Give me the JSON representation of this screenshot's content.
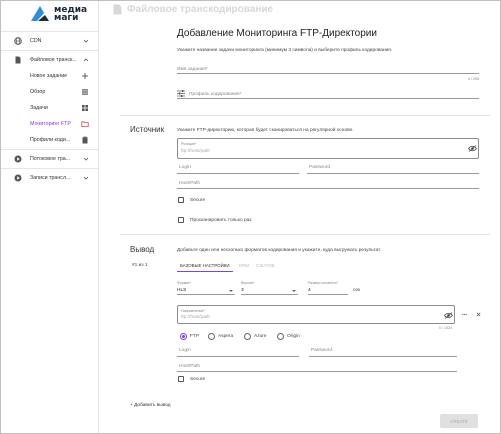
{
  "brand": {
    "line1": "медиа",
    "line2": "маги"
  },
  "header": {
    "title": "Файловое транскодирование"
  },
  "sidebar": {
    "items": [
      {
        "label": "CDN",
        "icon": "globe-icon"
      },
      {
        "label": "Файловое транск...",
        "icon": "file-icon"
      },
      {
        "label": "Новое задание",
        "action_icon": "plus-icon"
      },
      {
        "label": "Обзор",
        "action_icon": "list-icon"
      },
      {
        "label": "Задачи",
        "action_icon": "grid-icon"
      },
      {
        "label": "Мониторинг FTP",
        "action_icon": "folder-icon"
      },
      {
        "label": "Профили коди...",
        "action_icon": "clipboard-icon"
      },
      {
        "label": "Потоковое тра...",
        "icon": "play-circle-icon"
      },
      {
        "label": "Записи трансл...",
        "icon": "play-circle-icon"
      }
    ]
  },
  "form": {
    "title": "Добавление Мониторинга FTP-Директории",
    "intro": "Укажите название задачи мониторинга (минимум 3 символа) и выберите профиль кодирования.",
    "task_name_placeholder": "Имя задания*",
    "task_name_counter": "0 / 255",
    "profile_placeholder": "Профиль кодирования*",
    "source": {
      "title": "Источник",
      "hint": "Укажите FTP-директорию, которая будет сканироваться на регулярной основе.",
      "path_label": "Розиция*",
      "path_placeholder": "ftp://host/path",
      "login_placeholder": "Login",
      "password_placeholder": "Password",
      "hostpath_placeholder": "Host/Path",
      "secure_label": "Secure",
      "scan_once_label": "Просканировать только раз"
    },
    "output": {
      "title": "Вывод",
      "hint": "Добавьте один или несколько форматов кодирования и укажите, куда выгружать результат.",
      "counter": "#1 из 1",
      "tabs": [
        "БАЗОВЫЕ НАСТРОЙКИ",
        "DRM",
        "СЖАТИЕ"
      ],
      "format_label": "Формат*",
      "format_value": "HLS",
      "version_label": "Версия*",
      "version_value": "3",
      "segment_label": "Размер сегмента*",
      "segment_value": "4",
      "segment_unit": "сек",
      "destination_label": "Направление*",
      "destination_placeholder": "ftp://host/path",
      "destination_counter": "0 / 1024",
      "protocols": [
        "FTP",
        "Aspera",
        "Azure",
        "Origin"
      ],
      "protocol_selected": "FTP",
      "login_placeholder": "Login",
      "password_placeholder": "Password",
      "hostpath_placeholder": "Host/Path",
      "secure_label": "Secure",
      "add_output_label": "+ Добавить вывод"
    },
    "create_label": "CREATE"
  },
  "colors": {
    "accent": "#7e43d8",
    "logo_blue": "#2f8fd6",
    "logo_navy": "#1d2a3a"
  }
}
